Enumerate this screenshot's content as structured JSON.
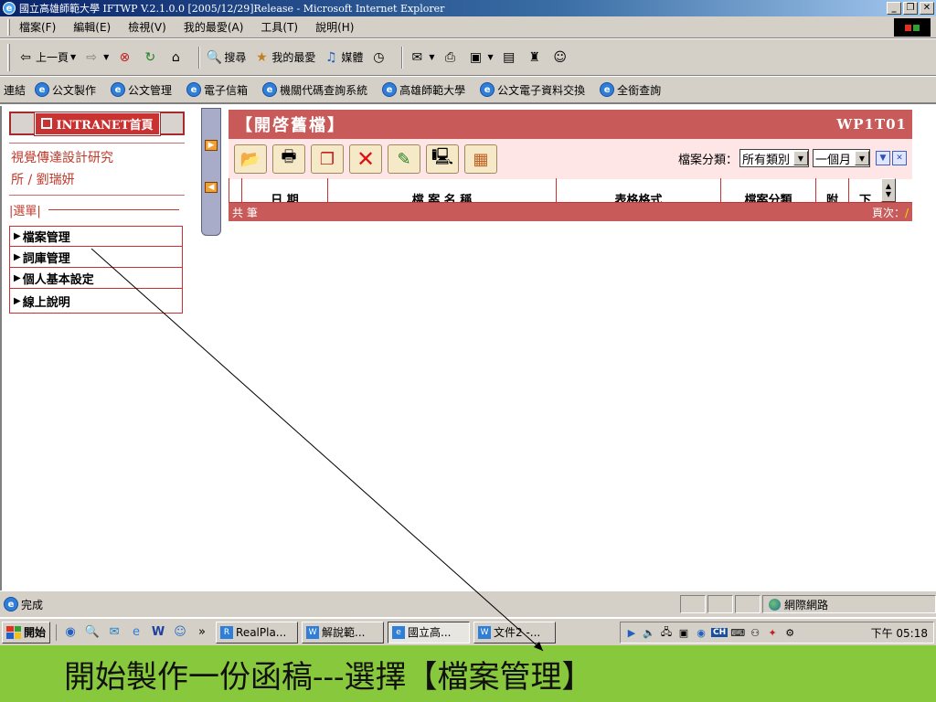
{
  "window": {
    "title": "國立高雄師範大學   IFTWP V.2.1.0.0 [2005/12/29]Release - Microsoft Internet Explorer",
    "controls": [
      "_",
      "❐",
      "✕"
    ]
  },
  "menubar": {
    "items": [
      "檔案(F)",
      "編輯(E)",
      "檢視(V)",
      "我的最愛(A)",
      "工具(T)",
      "說明(H)"
    ]
  },
  "toolbar": {
    "back": "上一頁",
    "search": "搜尋",
    "favorites": "我的最愛",
    "media": "媒體"
  },
  "links": {
    "label": "連結",
    "items": [
      "公文製作",
      "公文管理",
      "電子信箱",
      "機關代碼查詢系統",
      "高雄師範大學",
      "公文電子資料交換",
      "全銜查詢"
    ]
  },
  "sidebar": {
    "home_button": "INTRANET首頁",
    "user_line1": "視覺傳達設計研究",
    "user_line2": "所 / 劉瑞妍",
    "menu_label": "|選單|",
    "items": [
      "檔案管理",
      "詞庫管理",
      "個人基本設定",
      "線上說明"
    ]
  },
  "main": {
    "title": "【開啓舊檔】",
    "code": "WP1T01",
    "filter_label": "檔案分類：",
    "category_value": "所有類別",
    "period_value": "一個月",
    "columns": [
      "日 期",
      "檔 案 名 稱",
      "表格格式",
      "檔案分類",
      "附",
      "下"
    ],
    "total_label": "共 筆",
    "page_label": "頁次：",
    "page_value": "/"
  },
  "status": {
    "text": "完成",
    "zone": "網際網路"
  },
  "taskbar": {
    "start": "開始",
    "tasks": [
      "RealPla...",
      "解說範...",
      "國立高...",
      "文件2 -..."
    ],
    "active_task": "國立高...",
    "ime": "CH",
    "clock": "下午 05:18"
  },
  "caption": {
    "text": "開始製作一份函稿---選擇【檔案管理】"
  },
  "colors": {
    "accent": "#c85a5a",
    "caption_bg": "#88c83c",
    "title_bar": "#0a246a"
  }
}
